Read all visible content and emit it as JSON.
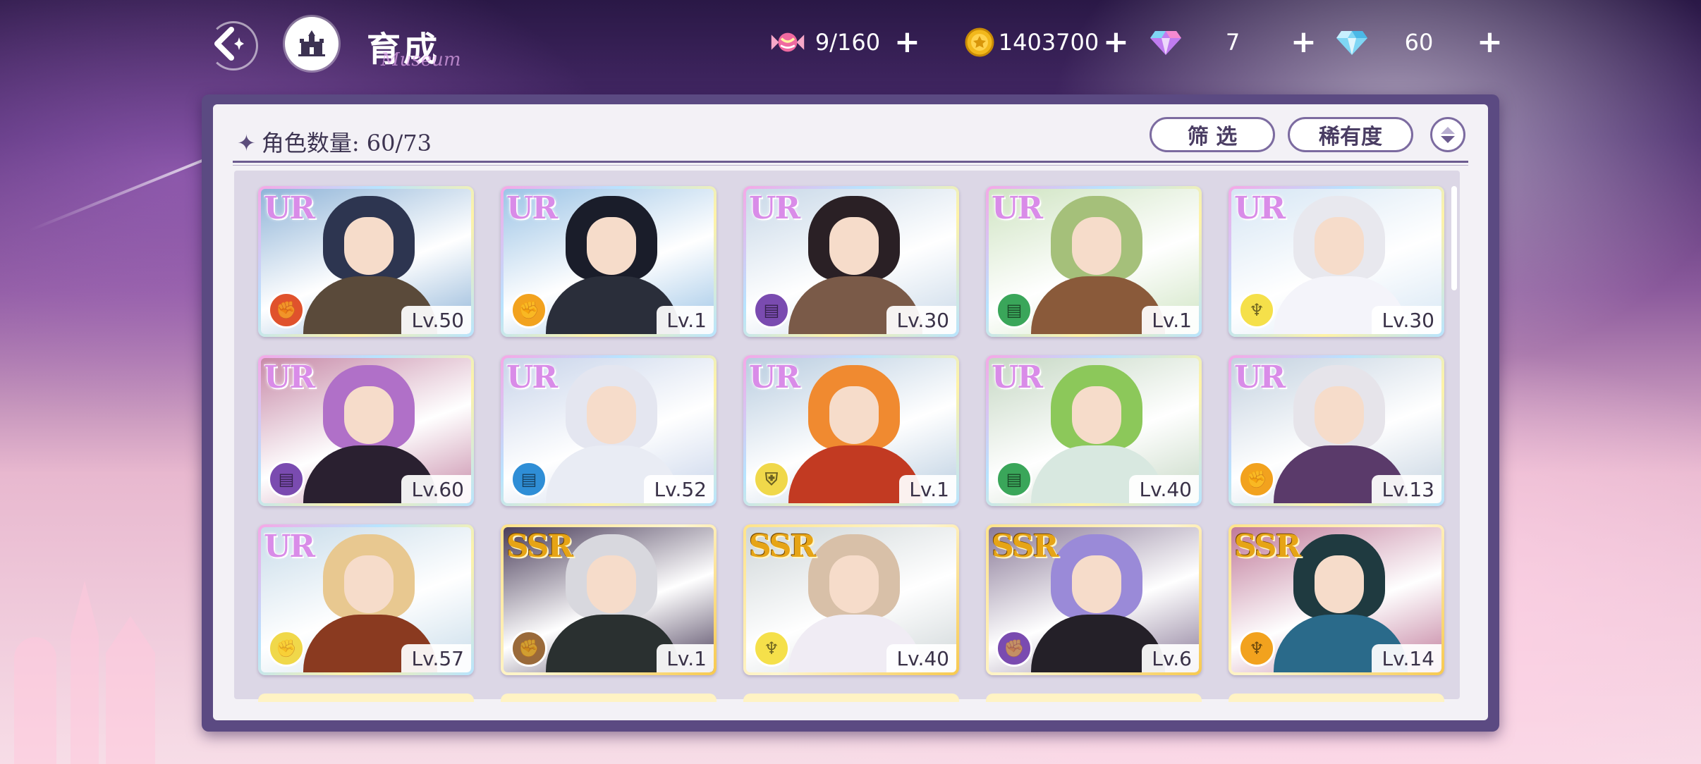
{
  "header": {
    "title": "育成",
    "title_deco": "Museum",
    "back_icon": "back-arrow-icon",
    "home_icon": "castle-icon"
  },
  "currencies": [
    {
      "name": "candy",
      "icon": "candy-icon",
      "value": "9/160",
      "color": "#f06aa0"
    },
    {
      "name": "gold",
      "icon": "gold-coin-icon",
      "value": "1403700",
      "color": "#f2b81c"
    },
    {
      "name": "rainbow-gem",
      "icon": "rainbow-gem-icon",
      "value": "7",
      "color": "#c07cf0"
    },
    {
      "name": "diamond",
      "icon": "diamond-icon",
      "value": "60",
      "color": "#7fd6f4"
    }
  ],
  "panel": {
    "count_label": "角色数量: 60/73",
    "filter_label": "筛 选",
    "rarity_label": "稀有度"
  },
  "cards": [
    {
      "rarity": "UR",
      "level": "Lv.50",
      "type_color": "#e0522c",
      "type_icon": "fist-icon",
      "hair": "#2d3550",
      "body": "#5a4a3a",
      "scene": "#8fb4d8"
    },
    {
      "rarity": "UR",
      "level": "Lv.1",
      "type_color": "#f2a21e",
      "type_icon": "fist-icon",
      "hair": "#1a1d2a",
      "body": "#2a2e3a",
      "scene": "#9cc4e6"
    },
    {
      "rarity": "UR",
      "level": "Lv.30",
      "type_color": "#7a4bb0",
      "type_icon": "book-icon",
      "hair": "#2a2025",
      "body": "#7a5a48",
      "scene": "#c8d8e8"
    },
    {
      "rarity": "UR",
      "level": "Lv.1",
      "type_color": "#3aa65a",
      "type_icon": "book-icon",
      "hair": "#a5c07a",
      "body": "#8a5a3a",
      "scene": "#cfe4c2"
    },
    {
      "rarity": "UR",
      "level": "Lv.30",
      "type_color": "#f5e04a",
      "type_icon": "staff-icon",
      "hair": "#e8e8ee",
      "body": "#f4f4fa",
      "scene": "#d6e6f4"
    },
    {
      "rarity": "UR",
      "level": "Lv.60",
      "type_color": "#7a4bb0",
      "type_icon": "book-icon",
      "hair": "#b070c8",
      "body": "#2a2030",
      "scene": "#c78aa8"
    },
    {
      "rarity": "UR",
      "level": "Lv.52",
      "type_color": "#2f8ed6",
      "type_icon": "book-icon",
      "hair": "#e4e6f0",
      "body": "#e9ecf4",
      "scene": "#c8d4ea"
    },
    {
      "rarity": "UR",
      "level": "Lv.1",
      "type_color": "#f0d84a",
      "type_icon": "shield-icon",
      "hair": "#f08a30",
      "body": "#c23a22",
      "scene": "#b9cde0"
    },
    {
      "rarity": "UR",
      "level": "Lv.40",
      "type_color": "#3aa65a",
      "type_icon": "book-icon",
      "hair": "#8cc85a",
      "body": "#d8e8e0",
      "scene": "#c6d8c4"
    },
    {
      "rarity": "UR",
      "level": "Lv.13",
      "type_color": "#f2a21e",
      "type_icon": "fist-icon",
      "hair": "#e6e4ea",
      "body": "#5a3a6a",
      "scene": "#c4d2e0"
    },
    {
      "rarity": "UR",
      "level": "Lv.57",
      "type_color": "#f0d84a",
      "type_icon": "fist-icon",
      "hair": "#e8c890",
      "body": "#8a3a20",
      "scene": "#c8dcea"
    },
    {
      "rarity": "SSR",
      "level": "Lv.1",
      "type_color": "#9a6a3a",
      "type_icon": "fist-icon",
      "hair": "#d8d8de",
      "body": "#2a3030",
      "scene": "#4a3d5a"
    },
    {
      "rarity": "SSR",
      "level": "Lv.40",
      "type_color": "#f5e04a",
      "type_icon": "staff-icon",
      "hair": "#d8c0a8",
      "body": "#f0ecf4",
      "scene": "#cfd6d8"
    },
    {
      "rarity": "SSR",
      "level": "Lv.6",
      "type_color": "#7a4bb0",
      "type_icon": "fist-icon",
      "hair": "#9a8ad8",
      "body": "#242028",
      "scene": "#8a7a98"
    },
    {
      "rarity": "SSR",
      "level": "Lv.14",
      "type_color": "#f2a21e",
      "type_icon": "staff-icon",
      "hair": "#1f3a40",
      "body": "#2a6a8a",
      "scene": "#c07a9a"
    }
  ]
}
